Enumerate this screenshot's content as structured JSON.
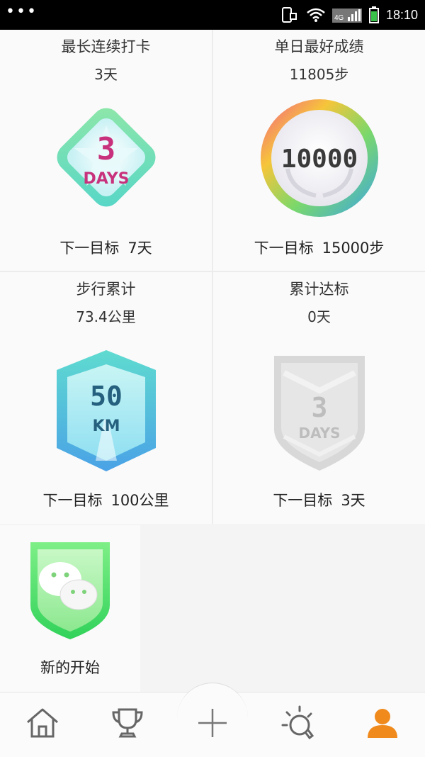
{
  "status_bar": {
    "network": "4G",
    "time": "18:10"
  },
  "achievements": [
    {
      "title": "最长连续打卡",
      "value": "3天",
      "badge_top": "3",
      "badge_bottom": "DAYS",
      "next_label": "下一目标",
      "next_value": "7天"
    },
    {
      "title": "单日最好成绩",
      "value": "11805步",
      "badge_text": "10000",
      "next_label": "下一目标",
      "next_value": "15000步"
    },
    {
      "title": "步行累计",
      "value": "73.4公里",
      "badge_top": "50",
      "badge_bottom": "KM",
      "next_label": "下一目标",
      "next_value": "100公里"
    },
    {
      "title": "累计达标",
      "value": "0天",
      "badge_top": "3",
      "badge_bottom": "DAYS",
      "next_label": "下一目标",
      "next_value": "3天"
    }
  ],
  "special_badge": {
    "name": "新的开始",
    "icon": "wechat-chat-icon"
  },
  "bottom_nav": [
    {
      "icon": "home-icon",
      "active": false
    },
    {
      "icon": "trophy-icon",
      "active": false
    },
    {
      "icon": "add-icon",
      "active": false
    },
    {
      "icon": "idea-bulb-icon",
      "active": false
    },
    {
      "icon": "profile-icon",
      "active": true
    }
  ],
  "colors": {
    "accent": "#f08a1d",
    "nav_inactive": "#666666"
  }
}
